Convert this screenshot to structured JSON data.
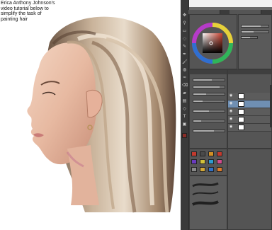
{
  "caption": {
    "text": "Erica Anthony Johnson's video tutorial below to simplify the task of painting hair"
  },
  "app": {
    "tabs": [
      "",
      ""
    ],
    "colors": {
      "panel_bg": "#555555",
      "toolbar_bg": "#3a3a3a",
      "accent_selected": "#6f8fb3",
      "active_color": "#8a2d28"
    },
    "tools": [
      "move-tool",
      "zoom-tool",
      "select-tool",
      "lasso-tool",
      "eyedropper-tool",
      "pen-tool",
      "brush-tool",
      "airbrush-tool",
      "blend-tool",
      "eraser-tool",
      "fill-tool",
      "gradient-tool",
      "shape-tool",
      "text-tool",
      "frame-tool"
    ],
    "layers": [
      {
        "name": "",
        "selected": false
      },
      {
        "name": "",
        "selected": true
      },
      {
        "name": "",
        "selected": false
      },
      {
        "name": "",
        "selected": false
      },
      {
        "name": "",
        "selected": false
      }
    ],
    "swatches": [
      "#c33a2e",
      "#4a4a4a",
      "#d28f25",
      "#c33a2e",
      "#6a3bbf",
      "#d3c23a",
      "#2d9bd1",
      "#d14b8f",
      "#8a8a8a",
      "#d2a737",
      "#2f6fc7",
      "#e07b2a"
    ],
    "brushes": [
      "",
      "",
      ""
    ]
  }
}
